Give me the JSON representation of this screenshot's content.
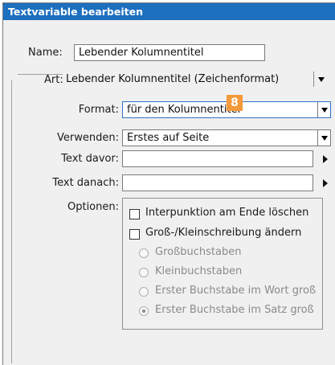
{
  "window": {
    "title": "Textvariable bearbeiten"
  },
  "name": {
    "label": "Name:",
    "value": "Lebender Kolumnentitel"
  },
  "art": {
    "label": "Art:",
    "selected": "Lebender Kolumnentitel (Zeichenformat)"
  },
  "format": {
    "label": "Format:",
    "selected": "für den Kolumnentitel"
  },
  "verwenden": {
    "label": "Verwenden:",
    "selected": "Erstes auf Seite"
  },
  "text_davor": {
    "label": "Text davor:",
    "value": ""
  },
  "text_danach": {
    "label": "Text danach:",
    "value": ""
  },
  "annotation_badge": "8",
  "optionen": {
    "label": "Optionen:",
    "checkboxes": [
      {
        "label": "Interpunktion am Ende löschen",
        "checked": false
      },
      {
        "label": "Groß-/Kleinschreibung ändern",
        "checked": false
      }
    ],
    "radios": [
      {
        "label": "Großbuchstaben",
        "selected": false,
        "enabled": false
      },
      {
        "label": "Kleinbuchstaben",
        "selected": false,
        "enabled": false
      },
      {
        "label": "Erster Buchstabe im Wort groß",
        "selected": false,
        "enabled": false
      },
      {
        "label": "Erster Buchstabe im Satz groß",
        "selected": true,
        "enabled": false
      }
    ]
  },
  "colors": {
    "titlebar": "#1d6fbf",
    "badge": "#f39a3a",
    "dialog_bg": "#f0f0f0"
  }
}
